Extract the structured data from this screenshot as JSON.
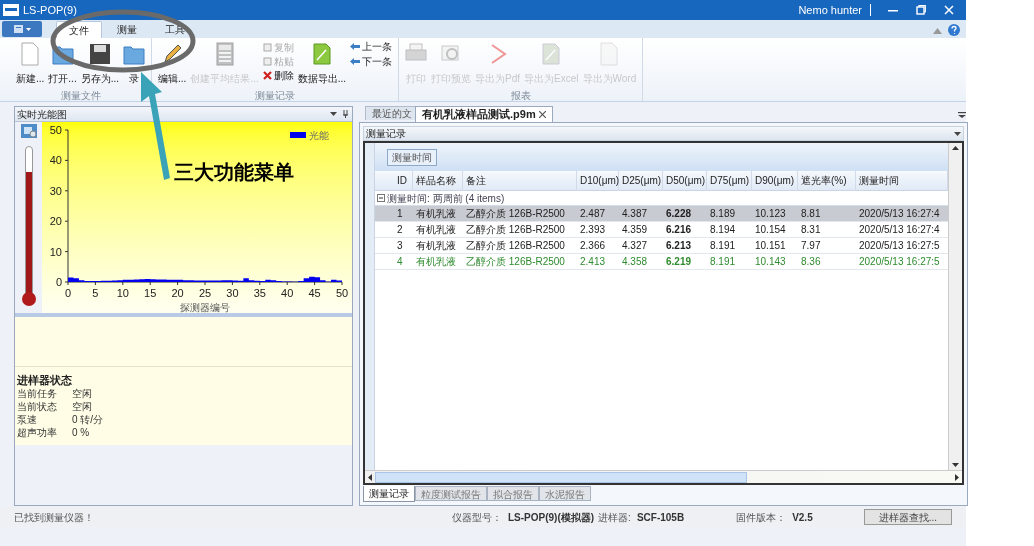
{
  "window": {
    "title": "LS-POP(9)",
    "user": "Nemo hunter"
  },
  "ribbon_tabs": [
    {
      "label": "文件",
      "selected": true
    },
    {
      "label": "测量",
      "selected": false
    },
    {
      "label": "工具",
      "selected": false
    }
  ],
  "ribbon_groups": [
    {
      "label": "测量文件",
      "buttons": [
        {
          "label": "新建...",
          "disabled": false
        },
        {
          "label": "打开...",
          "disabled": false
        },
        {
          "label": "另存为...",
          "disabled": false
        },
        {
          "label": "录",
          "disabled": false
        }
      ]
    },
    {
      "label": "测量记录",
      "buttons": [
        {
          "label": "编辑...",
          "disabled": false
        },
        {
          "label": "创建平均结果...",
          "disabled": true
        }
      ],
      "small_buttons": [
        {
          "label": "复制",
          "disabled": true
        },
        {
          "label": "粘贴",
          "disabled": true
        },
        {
          "label": "删除",
          "disabled": false
        }
      ],
      "buttons_after": [
        {
          "label": "数据导出...",
          "disabled": false
        }
      ],
      "nav_buttons": [
        {
          "label": "上一条",
          "disabled": false
        },
        {
          "label": "下一条",
          "disabled": false
        }
      ]
    },
    {
      "label": "报表",
      "buttons": [
        {
          "label": "打印",
          "disabled": true
        },
        {
          "label": "打印预览",
          "disabled": true
        },
        {
          "label": "导出为Pdf",
          "disabled": true
        },
        {
          "label": "导出为Excel",
          "disabled": true
        },
        {
          "label": "导出为Word",
          "disabled": true
        }
      ]
    }
  ],
  "annotation": {
    "text": "三大功能菜单"
  },
  "left_panel": {
    "title": "实时光能图",
    "thermometer": {
      "level": 0.83
    },
    "plot": {
      "xlabel": "探测器编号",
      "legend": "光能",
      "x_ticks": [
        "0",
        "5",
        "10",
        "15",
        "20",
        "25",
        "30",
        "35",
        "40",
        "45",
        "50"
      ],
      "y_ticks": [
        "50",
        "40",
        "30",
        "20",
        "10",
        "0"
      ]
    },
    "sampler": {
      "title": "进样器状态",
      "fields": [
        {
          "label": "当前任务",
          "value": "空闲"
        },
        {
          "label": "当前状态",
          "value": "空闲"
        },
        {
          "label": "泵速",
          "value": "0 转/分"
        },
        {
          "label": "超声功率",
          "value": "0 %"
        }
      ]
    }
  },
  "doc_tabs": [
    {
      "label": "最近的文",
      "selected": false,
      "closable": false
    },
    {
      "label": "有机乳液样品测试.p9m",
      "selected": true,
      "closable": true
    }
  ],
  "records": {
    "title": "测量记录",
    "group_chip": "测量时间",
    "columns": [
      "ID",
      "样品名称",
      "备注",
      "D10(μm)",
      "D25(μm)",
      "D50(μm)",
      "D75(μm)",
      "D90(μm)",
      "遮光率(%)",
      "测量时间"
    ],
    "group": "测量时间: 两周前 (4 items)",
    "rows": [
      {
        "cells": [
          "1",
          "有机乳液",
          "乙醇介质 126B-R2500",
          "2.487",
          "4.387",
          "6.228",
          "8.189",
          "10.123",
          "8.81",
          "2020/5/13 16:27:4"
        ],
        "selected": true,
        "color": "#222222"
      },
      {
        "cells": [
          "2",
          "有机乳液",
          "乙醇介质 126B-R2500",
          "2.393",
          "4.359",
          "6.216",
          "8.194",
          "10.154",
          "8.31",
          "2020/5/13 16:27:4"
        ],
        "selected": false,
        "color": "#222222"
      },
      {
        "cells": [
          "3",
          "有机乳液",
          "乙醇介质 126B-R2500",
          "2.366",
          "4.327",
          "6.213",
          "8.191",
          "10.151",
          "7.97",
          "2020/5/13 16:27:5"
        ],
        "selected": false,
        "color": "#222222"
      },
      {
        "cells": [
          "4",
          "有机乳液",
          "乙醇介质 126B-R2500",
          "2.413",
          "4.358",
          "6.219",
          "8.191",
          "10.143",
          "8.36",
          "2020/5/13 16:27:5"
        ],
        "selected": false,
        "color": "#2e8b2e"
      }
    ]
  },
  "bottom_tabs": [
    {
      "label": "测量记录",
      "selected": true
    },
    {
      "label": "粒度测试报告",
      "selected": false
    },
    {
      "label": "拟合报告",
      "selected": false
    },
    {
      "label": "水泥报告",
      "selected": false
    }
  ],
  "status_bar": {
    "message": "已找到测量仪器！",
    "items": [
      {
        "label": "仪器型号：",
        "value": "LS-POP(9)(模拟器)"
      },
      {
        "label": "进样器:",
        "value": "SCF-105B"
      },
      {
        "label": "固件版本：",
        "value": "V2.5"
      }
    ],
    "button": "进样器查找..."
  }
}
